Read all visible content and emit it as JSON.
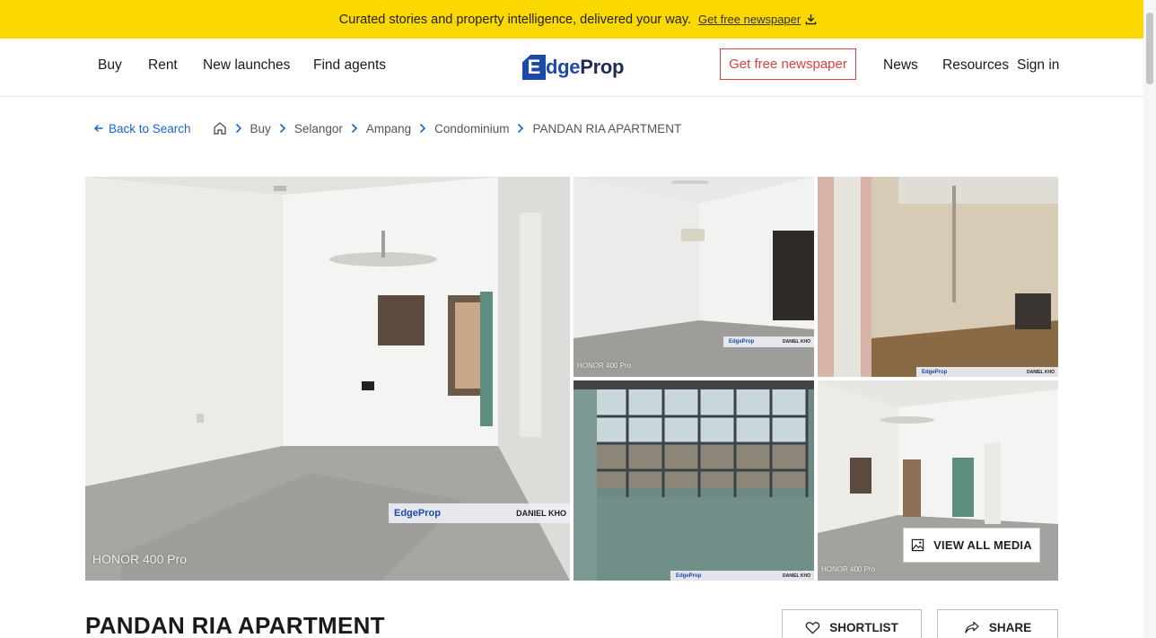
{
  "banner": {
    "text": "Curated stories and property intelligence, delivered your way.",
    "link": "Get free newspaper",
    "link_icon": "download-icon"
  },
  "nav": {
    "left": [
      "Buy",
      "Rent",
      "New launches",
      "Find agents"
    ],
    "logo_e": "E",
    "logo_rest": "dge",
    "logo_prop": "Prop",
    "newspaper_button": "Get free newspaper",
    "right": [
      "News",
      "Resources",
      "Sign in"
    ]
  },
  "breadcrumb": {
    "back": "Back to Search",
    "items": [
      "Buy",
      "Selangor",
      "Ampang",
      "Condominium",
      "PANDAN RIA APARTMENT"
    ],
    "home_icon": "home-icon"
  },
  "gallery": {
    "watermark_brand": "EdgeProp",
    "watermark_agent": "DANIEL KHO",
    "camera_label": "HONOR 400 Pro",
    "view_media": "VIEW ALL MEDIA"
  },
  "listing": {
    "title": "PANDAN RIA APARTMENT",
    "shortlist": "SHORTLIST",
    "share": "SHARE"
  },
  "colors": {
    "banner": "#fbd800",
    "link_blue": "#1766d1",
    "brand_blue": "#1d4aa8",
    "accent_red": "#d94040"
  }
}
